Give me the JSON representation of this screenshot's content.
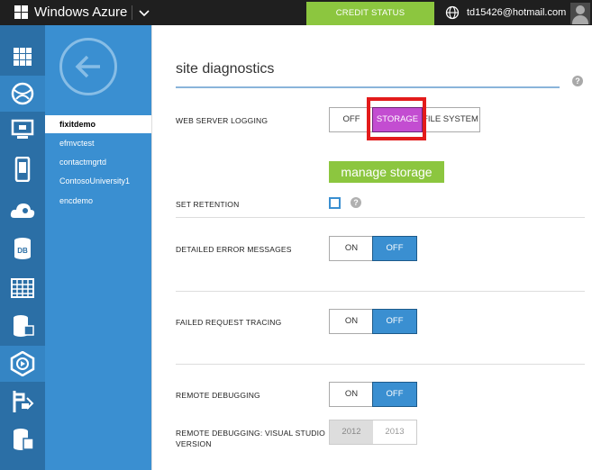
{
  "topbar": {
    "brand": "Windows Azure",
    "credit_status": "CREDIT STATUS",
    "user_email": "td15426@hotmail.com"
  },
  "rail": {
    "icons": [
      "all-items-icon",
      "web-sites-icon",
      "virtual-machines-icon",
      "mobile-services-icon",
      "cloud-services-icon",
      "sql-databases-icon",
      "storage-icon",
      "hdinsight-icon",
      "media-services-icon",
      "service-bus-icon",
      "networks-icon"
    ]
  },
  "nav": {
    "sites": [
      {
        "label": "fixitdemo",
        "selected": true
      },
      {
        "label": "efmvctest",
        "selected": false
      },
      {
        "label": "contactmgrtd",
        "selected": false
      },
      {
        "label": "ContosoUniversity1",
        "selected": false
      },
      {
        "label": "encdemo",
        "selected": false
      }
    ]
  },
  "main": {
    "title": "site diagnostics",
    "web_server_logging": {
      "label": "WEB SERVER LOGGING",
      "options": [
        "OFF",
        "STORAGE",
        "FILE SYSTEM"
      ],
      "selected": "STORAGE"
    },
    "manage_storage": "manage storage",
    "set_retention": {
      "label": "SET RETENTION",
      "checked": false
    },
    "detailed_errors": {
      "label": "DETAILED ERROR MESSAGES",
      "on": "ON",
      "off": "OFF",
      "selected": "OFF"
    },
    "failed_request_tracing": {
      "label": "FAILED REQUEST TRACING",
      "on": "ON",
      "off": "OFF",
      "selected": "OFF"
    },
    "remote_debugging": {
      "label": "REMOTE DEBUGGING",
      "on": "ON",
      "off": "OFF",
      "selected": "OFF"
    },
    "remote_debugging_vs": {
      "label_line1": "REMOTE DEBUGGING: VISUAL STUDIO",
      "label_line2": "VERSION",
      "options": [
        "2012",
        "2013"
      ]
    }
  },
  "colors": {
    "accent_blue": "#3a8fd1",
    "rail_blue": "#2b6fa6",
    "green": "#8cc63f",
    "storage_purple": "#c34dd1",
    "highlight_red": "#e31b1b"
  }
}
